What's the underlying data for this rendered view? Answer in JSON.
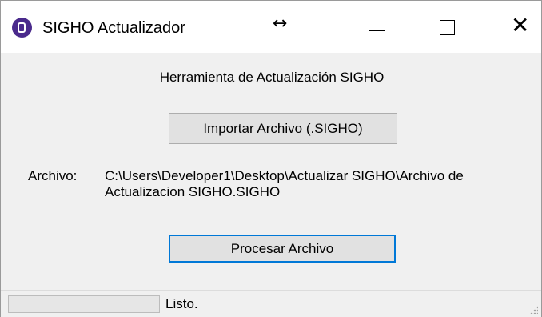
{
  "window": {
    "title": "SIGHO Actualizador",
    "icon": "sigho-app-icon",
    "cursor_icon": "resize-horizontal-cursor"
  },
  "controls": {
    "minimize": "—",
    "maximize": "□",
    "close": "✕"
  },
  "main": {
    "heading": "Herramienta de Actualización SIGHO",
    "import_button": "Importar Archivo (.SIGHO)",
    "file_label": "Archivo:",
    "file_path": "C:\\Users\\Developer1\\Desktop\\Actualizar SIGHO\\Archivo de Actualizacion SIGHO.SIGHO",
    "process_button": "Procesar Archivo"
  },
  "status": {
    "progress_fraction": 0,
    "text": "Listo."
  },
  "colors": {
    "accent_focus": "#0078d7",
    "app_icon": "#4a2a8c",
    "progress_fill": "#06b025"
  }
}
